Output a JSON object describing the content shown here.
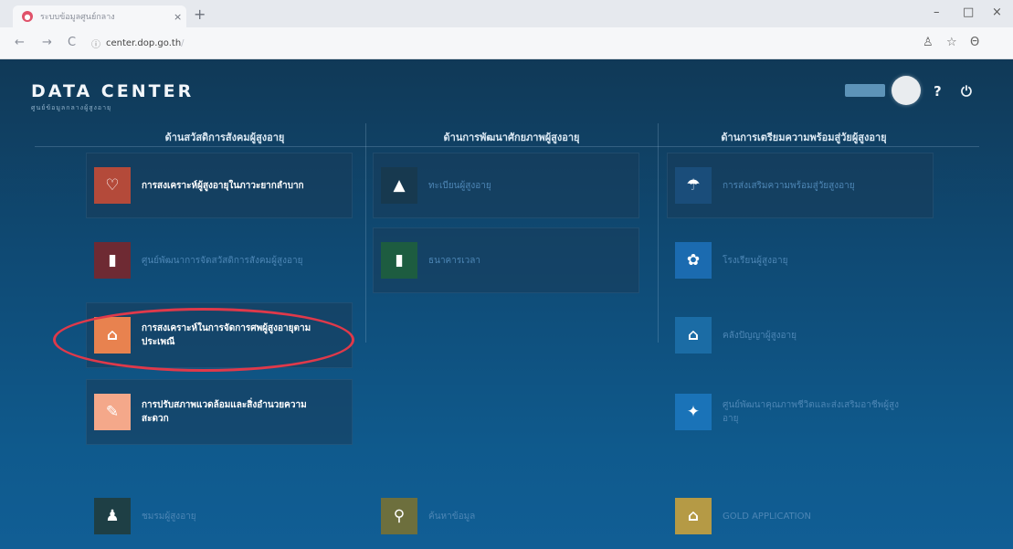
{
  "browser": {
    "tab_title": "ระบบข้อมูลศูนย์กลาง",
    "tab_close": "×",
    "new_tab": "+",
    "url_host": "center.dop.go.th",
    "url_path": "/",
    "nav": {
      "back": "←",
      "forward": "→",
      "reload": "C",
      "info": "ⓘ"
    },
    "window_controls": {
      "minimize": "–",
      "maximize": "□",
      "close": "×"
    },
    "toolbar_icons": {
      "person": "♙",
      "star": "☆",
      "profile": "Θ"
    }
  },
  "header": {
    "title": "DATA CENTER",
    "subtitle": "ศูนย์ข้อมูลกลางผู้สูงอายุ",
    "help_icon": "?",
    "power_icon": "⏻"
  },
  "columns": [
    {
      "title": "ด้านสวัสดิการสังคมผู้สูงอายุ"
    },
    {
      "title": "ด้านการพัฒนาศักยภาพผู้สูงอายุ"
    },
    {
      "title": "ด้านการเตรียมความพร้อมสู่วัยผู้สูงอายุ"
    }
  ],
  "cards": [
    {
      "label": "การสงเคราะห์ผู้สูงอายุในภาวะยากลำบาก",
      "icon": "♡",
      "color": "#b44a3a"
    },
    {
      "label": "ศูนย์พัฒนาการจัดสวัสดิการสังคมผู้สูงอายุ",
      "icon": "▮",
      "color": "#6e2a33"
    },
    {
      "label": "การสงเคราะห์ในการจัดการศพผู้สูงอายุตามประเพณี",
      "icon": "⌂",
      "color": "#e8824f"
    },
    {
      "label": "การปรับสภาพแวดล้อมและสิ่งอำนวยความสะดวก",
      "icon": "✎",
      "color": "#f4a88a"
    },
    {
      "label": "ทะเบียนผู้สูงอายุ",
      "icon": "▲",
      "color": "#17394f"
    },
    {
      "label": "ธนาคารเวลา",
      "icon": "▮",
      "color": "#1d5c40"
    },
    {
      "label": "การส่งเสริมความพร้อมสู่วัยสูงอายุ",
      "icon": "☂",
      "color": "#1a4d7a"
    },
    {
      "label": "โรงเรียนผู้สูงอายุ",
      "icon": "✿",
      "color": "#1b6bb0"
    },
    {
      "label": "คลังปัญญาผู้สูงอายุ",
      "icon": "⌂",
      "color": "#1b6ca5"
    },
    {
      "label": "ศูนย์พัฒนาคุณภาพชีวิตและส่งเสริมอาชีพผู้สูงอายุ",
      "icon": "✦",
      "color": "#1a73b8"
    },
    {
      "label": "ชมรมผู้สูงอายุ",
      "icon": "♟",
      "color": "#1e3f45"
    },
    {
      "label": "ค้นหาข้อมูล",
      "icon": "⚲",
      "color": "#6d6f3d"
    },
    {
      "label": "GOLD APPLICATION",
      "icon": "⌂",
      "color": "#b59a45"
    }
  ]
}
